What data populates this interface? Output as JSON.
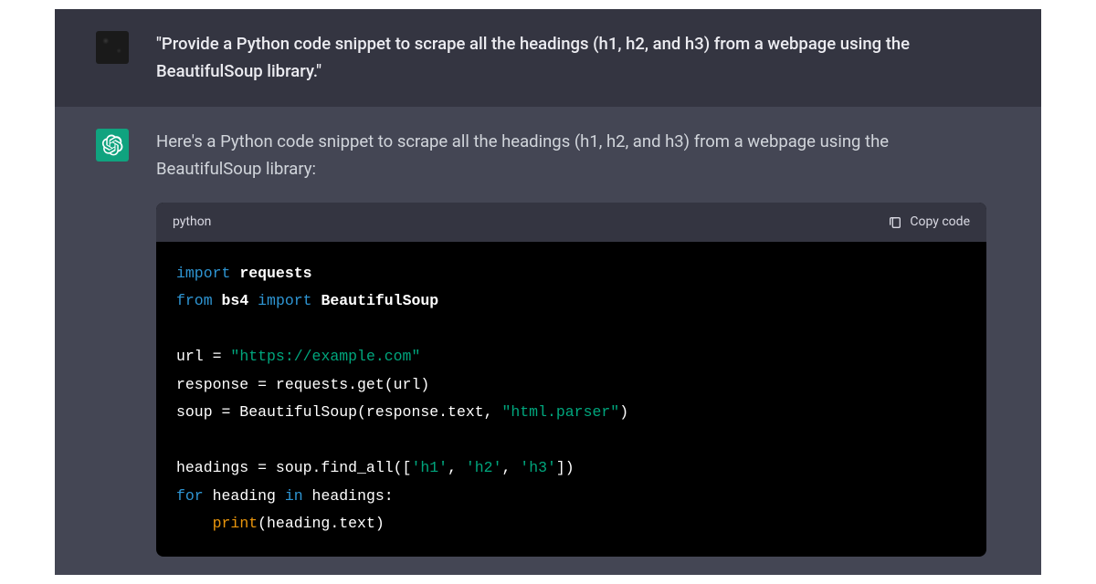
{
  "user_message": "\"Provide a Python code snippet to scrape all the headings (h1, h2, and h3) from a webpage using the BeautifulSoup library.\"",
  "assistant_intro": "Here's a Python code snippet to scrape all the headings (h1, h2, and h3) from a webpage using the BeautifulSoup library:",
  "code_block": {
    "language": "python",
    "copy_label": "Copy code",
    "tokens": [
      {
        "t": "import",
        "c": "keyword"
      },
      {
        "t": " ",
        "c": null
      },
      {
        "t": "requests",
        "c": "module"
      },
      {
        "t": "\n",
        "c": null
      },
      {
        "t": "from",
        "c": "keyword"
      },
      {
        "t": " ",
        "c": null
      },
      {
        "t": "bs4",
        "c": "module"
      },
      {
        "t": " ",
        "c": null
      },
      {
        "t": "import",
        "c": "keyword"
      },
      {
        "t": " ",
        "c": null
      },
      {
        "t": "BeautifulSoup",
        "c": "module"
      },
      {
        "t": "\n",
        "c": null
      },
      {
        "t": "\n",
        "c": null
      },
      {
        "t": "url = ",
        "c": "ident"
      },
      {
        "t": "\"https://example.com\"",
        "c": "string"
      },
      {
        "t": "\n",
        "c": null
      },
      {
        "t": "response = requests.get(url)",
        "c": "ident"
      },
      {
        "t": "\n",
        "c": null
      },
      {
        "t": "soup = BeautifulSoup(response.text, ",
        "c": "ident"
      },
      {
        "t": "\"html.parser\"",
        "c": "string"
      },
      {
        "t": ")",
        "c": "ident"
      },
      {
        "t": "\n",
        "c": null
      },
      {
        "t": "\n",
        "c": null
      },
      {
        "t": "headings = soup.find_all([",
        "c": "ident"
      },
      {
        "t": "'h1'",
        "c": "string"
      },
      {
        "t": ", ",
        "c": "ident"
      },
      {
        "t": "'h2'",
        "c": "string"
      },
      {
        "t": ", ",
        "c": "ident"
      },
      {
        "t": "'h3'",
        "c": "string"
      },
      {
        "t": "])",
        "c": "ident"
      },
      {
        "t": "\n",
        "c": null
      },
      {
        "t": "for",
        "c": "keyword"
      },
      {
        "t": " heading ",
        "c": "ident"
      },
      {
        "t": "in",
        "c": "keyword"
      },
      {
        "t": " headings:",
        "c": "ident"
      },
      {
        "t": "\n",
        "c": null
      },
      {
        "t": "    ",
        "c": null
      },
      {
        "t": "print",
        "c": "builtin"
      },
      {
        "t": "(heading.text)",
        "c": "ident"
      }
    ]
  }
}
